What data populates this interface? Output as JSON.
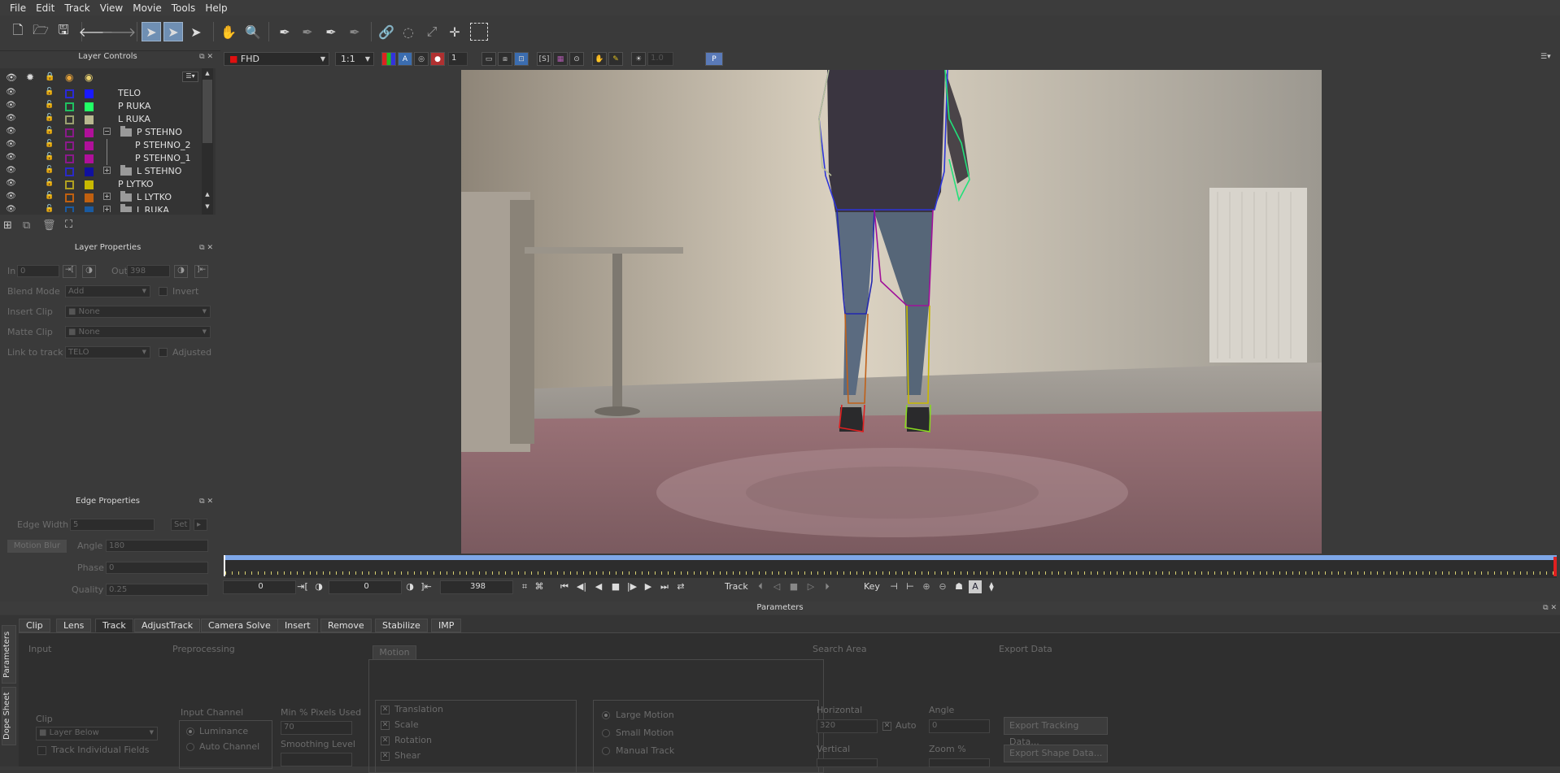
{
  "menu": [
    "File",
    "Edit",
    "Track",
    "View",
    "Movie",
    "Tools",
    "Help"
  ],
  "viewer_bar": {
    "clip": "FHD",
    "zoom": "1:1",
    "frame_field": "1",
    "overlay_value": "1.0",
    "p_label": "P"
  },
  "layer_controls": {
    "title": "Layer Controls",
    "layers": [
      {
        "name": "TELO",
        "outline": "#2a2ad8",
        "fill": "#1a1aff",
        "indent": 0,
        "group": false
      },
      {
        "name": "P RUKA",
        "outline": "#20c060",
        "fill": "#22ff66",
        "indent": 0,
        "group": false
      },
      {
        "name": "L RUKA",
        "outline": "#9aa070",
        "fill": "#b8b890",
        "indent": 0,
        "group": false
      },
      {
        "name": "P STEHNO",
        "outline": "#8a1a8a",
        "fill": "#b0109a",
        "indent": 1,
        "group": true,
        "expander": "−"
      },
      {
        "name": "P STEHNO_2",
        "outline": "#8a1a8a",
        "fill": "#b0109a",
        "indent": 2,
        "group": false
      },
      {
        "name": "P STEHNO_1",
        "outline": "#8a1a8a",
        "fill": "#b0109a",
        "indent": 2,
        "group": false
      },
      {
        "name": "L STEHNO",
        "outline": "#2a2ac8",
        "fill": "#1010a0",
        "indent": 1,
        "group": true,
        "expander": "+"
      },
      {
        "name": "P LYTKO",
        "outline": "#b0a020",
        "fill": "#c8b800",
        "indent": 0,
        "group": false
      },
      {
        "name": "L LYTKO",
        "outline": "#c06010",
        "fill": "#c06010",
        "indent": 1,
        "group": true,
        "expander": "+"
      },
      {
        "name": "L RUKA",
        "outline": "#1a5aa0",
        "fill": "#1a5aa0",
        "indent": 1,
        "group": true,
        "expander": "+"
      }
    ]
  },
  "layer_properties": {
    "title": "Layer Properties",
    "in_label": "In",
    "in_value": "0",
    "out_label": "Out",
    "out_value": "398",
    "blend_label": "Blend Mode",
    "blend_value": "Add",
    "invert_label": "Invert",
    "insert_label": "Insert Clip",
    "insert_value": "None",
    "matte_label": "Matte Clip",
    "matte_value": "None",
    "link_label": "Link to track",
    "link_value": "TELO",
    "adjusted_label": "Adjusted"
  },
  "edge_properties": {
    "title": "Edge Properties",
    "width_label": "Edge Width",
    "width_value": "5",
    "set_label": "Set",
    "motion_blur_label": "Motion Blur",
    "angle_label": "Angle",
    "angle_value": "180",
    "phase_label": "Phase",
    "phase_value": "0",
    "quality_label": "Quality",
    "quality_value": "0.25"
  },
  "transport": {
    "start": "0",
    "current": "0",
    "end": "398",
    "track_label": "Track",
    "key_label": "Key"
  },
  "parameters": {
    "title": "Parameters",
    "tabs": [
      "Clip",
      "Lens",
      "Track",
      "AdjustTrack",
      "Camera Solve",
      "Insert",
      "Remove",
      "Stabilize",
      "IMP"
    ],
    "active_tab": "Track",
    "side_tabs": [
      "Parameters",
      "Dope Sheet"
    ],
    "input": {
      "title": "Input",
      "clip_label": "Clip",
      "clip_value": "Layer Below",
      "track_fields": "Track Individual Fields"
    },
    "preprocessing": {
      "title": "Preprocessing",
      "input_channel": "Input Channel",
      "luminance": "Luminance",
      "auto_channel": "Auto Channel",
      "min_pixels": "Min % Pixels Used",
      "min_pixels_value": "70",
      "smoothing": "Smoothing Level"
    },
    "motion": {
      "title": "Motion",
      "translation": "Translation",
      "scale": "Scale",
      "rotation": "Rotation",
      "shear": "Shear",
      "large": "Large Motion",
      "small": "Small Motion",
      "manual": "Manual Track"
    },
    "search_area": {
      "title": "Search Area",
      "horizontal": "Horizontal",
      "horizontal_value": "320",
      "auto": "Auto",
      "angle": "Angle",
      "angle_value": "0",
      "vertical": "Vertical",
      "zoom": "Zoom %"
    },
    "export": {
      "title": "Export Data",
      "tracking": "Export Tracking Data...",
      "shape": "Export Shape Data..."
    }
  }
}
